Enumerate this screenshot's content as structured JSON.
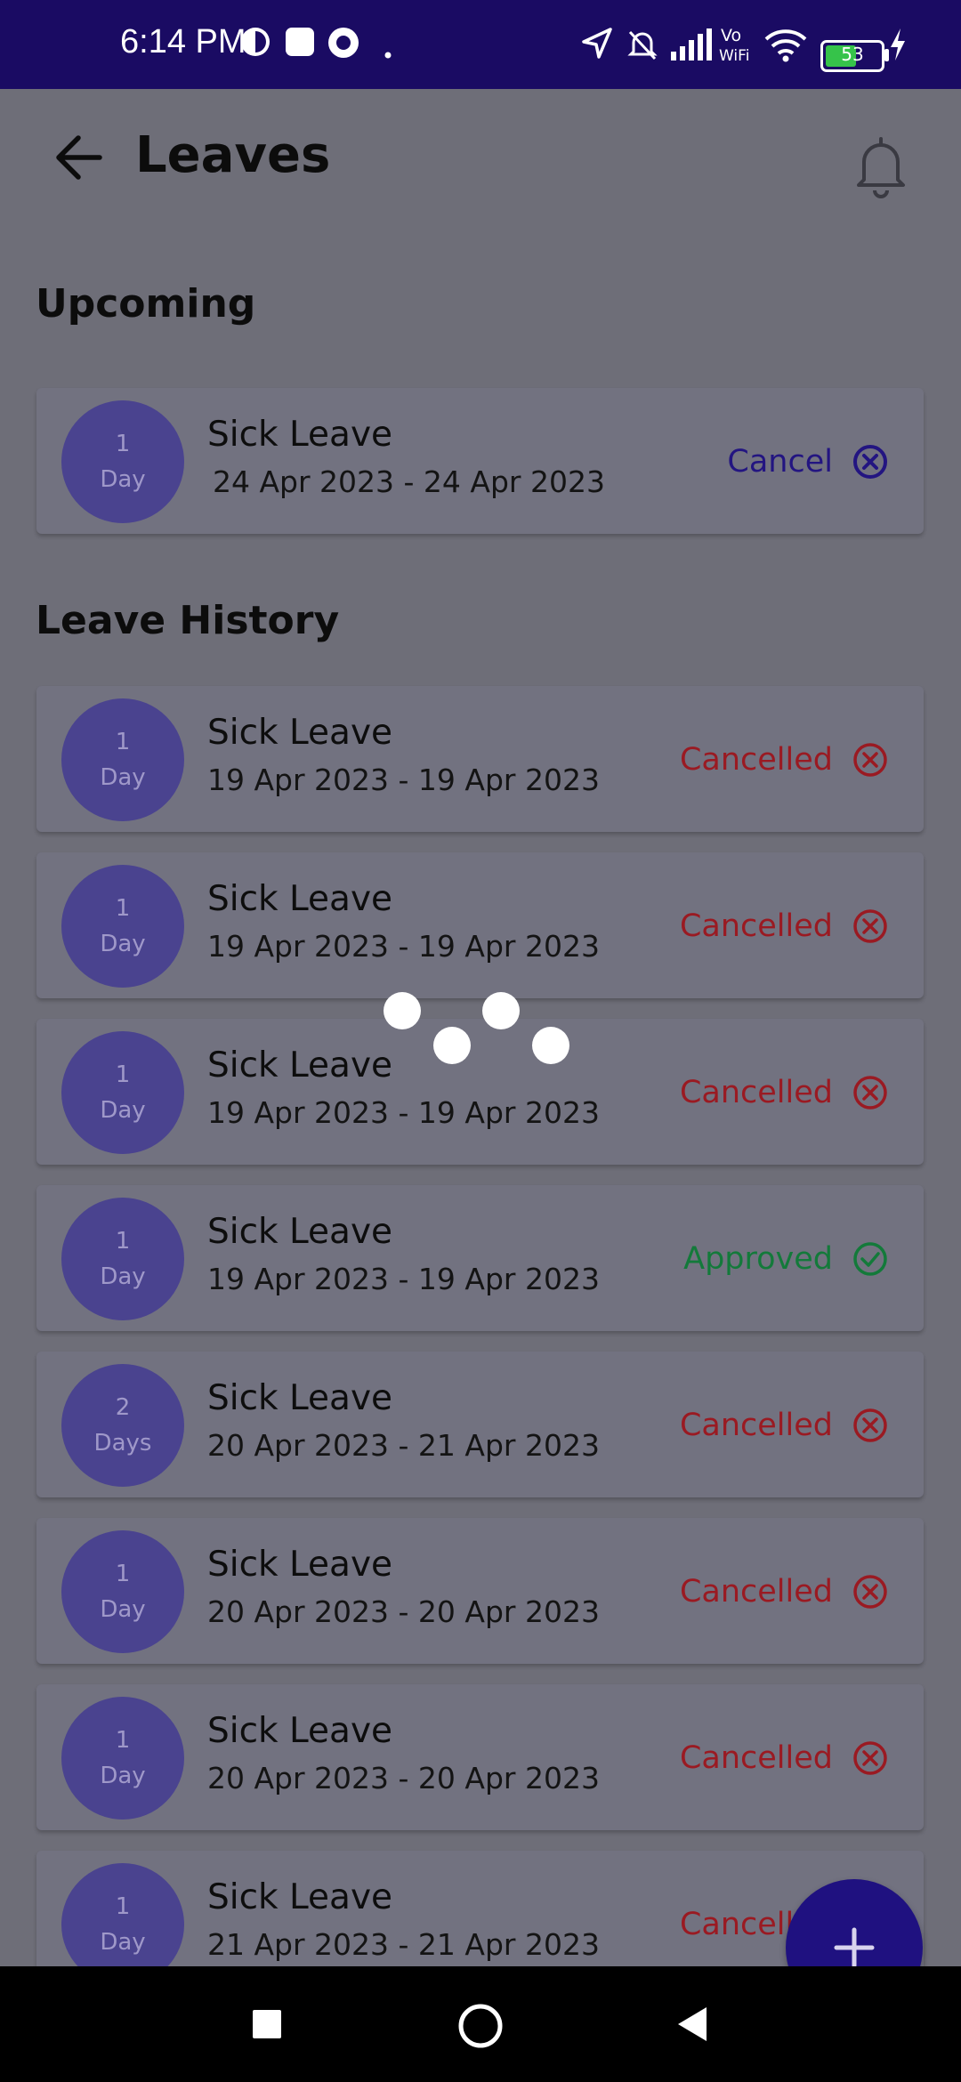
{
  "status_bar": {
    "time": "6:14 PM",
    "battery": "53"
  },
  "header": {
    "title": "Leaves"
  },
  "sections": {
    "upcoming": "Upcoming",
    "history": "Leave History"
  },
  "upcoming": [
    {
      "count": "1",
      "unit": "Day",
      "type": "Sick Leave",
      "dates": "24 Apr 2023 - 24 Apr 2023",
      "action": "Cancel"
    }
  ],
  "history": [
    {
      "count": "1",
      "unit": "Day",
      "type": "Sick Leave",
      "dates": "19 Apr 2023 - 19 Apr 2023",
      "status": "Cancelled"
    },
    {
      "count": "1",
      "unit": "Day",
      "type": "Sick Leave",
      "dates": "19 Apr 2023 - 19 Apr 2023",
      "status": "Cancelled"
    },
    {
      "count": "1",
      "unit": "Day",
      "type": "Sick Leave",
      "dates": "19 Apr 2023 - 19 Apr 2023",
      "status": "Cancelled"
    },
    {
      "count": "1",
      "unit": "Day",
      "type": "Sick Leave",
      "dates": "19 Apr 2023 - 19 Apr 2023",
      "status": "Approved"
    },
    {
      "count": "2",
      "unit": "Days",
      "type": "Sick Leave",
      "dates": "20 Apr 2023 - 21 Apr 2023",
      "status": "Cancelled"
    },
    {
      "count": "1",
      "unit": "Day",
      "type": "Sick Leave",
      "dates": "20 Apr 2023 - 20 Apr 2023",
      "status": "Cancelled"
    },
    {
      "count": "1",
      "unit": "Day",
      "type": "Sick Leave",
      "dates": "20 Apr 2023 - 20 Apr 2023",
      "status": "Cancelled"
    },
    {
      "count": "1",
      "unit": "Day",
      "type": "Sick Leave",
      "dates": "21 Apr 2023 - 21 Apr 2023",
      "status": "Cancelled"
    }
  ],
  "colors": {
    "primary": "#1f1180",
    "cancelled": "#9a1a22",
    "approved": "#137a3a",
    "statusbar": "#1a0b63"
  },
  "icons": {
    "back": "arrow-left-icon",
    "bell": "bell-icon",
    "fab": "plus-icon"
  }
}
